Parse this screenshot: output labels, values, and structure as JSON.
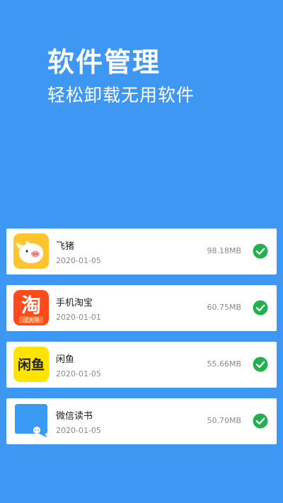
{
  "header": {
    "title": "软件管理",
    "subtitle": "轻松卸载无用软件"
  },
  "colors": {
    "background": "#3f97f4",
    "check": "#22b14c",
    "fliggy": "#ffc52e",
    "taobao": "#ff4a1c",
    "xianyu": "#ffe400",
    "weread": "#3a9bf5"
  },
  "apps": [
    {
      "name": "飞猪",
      "date": "2020-01-05",
      "size": "98.18MB",
      "icon": "fliggy-pig-icon",
      "selected": true
    },
    {
      "name": "手机淘宝",
      "date": "2020-01-01",
      "size": "60.75MB",
      "icon": "taobao-icon",
      "icon_text": "淘",
      "icon_badge": "过大年",
      "selected": true
    },
    {
      "name": "闲鱼",
      "date": "2020-01-05",
      "size": "55.66MB",
      "icon": "xianyu-icon",
      "icon_text": "闲鱼",
      "selected": true
    },
    {
      "name": "微信读书",
      "date": "2020-01-05",
      "size": "50.70MB",
      "icon": "weread-icon",
      "selected": true
    }
  ]
}
